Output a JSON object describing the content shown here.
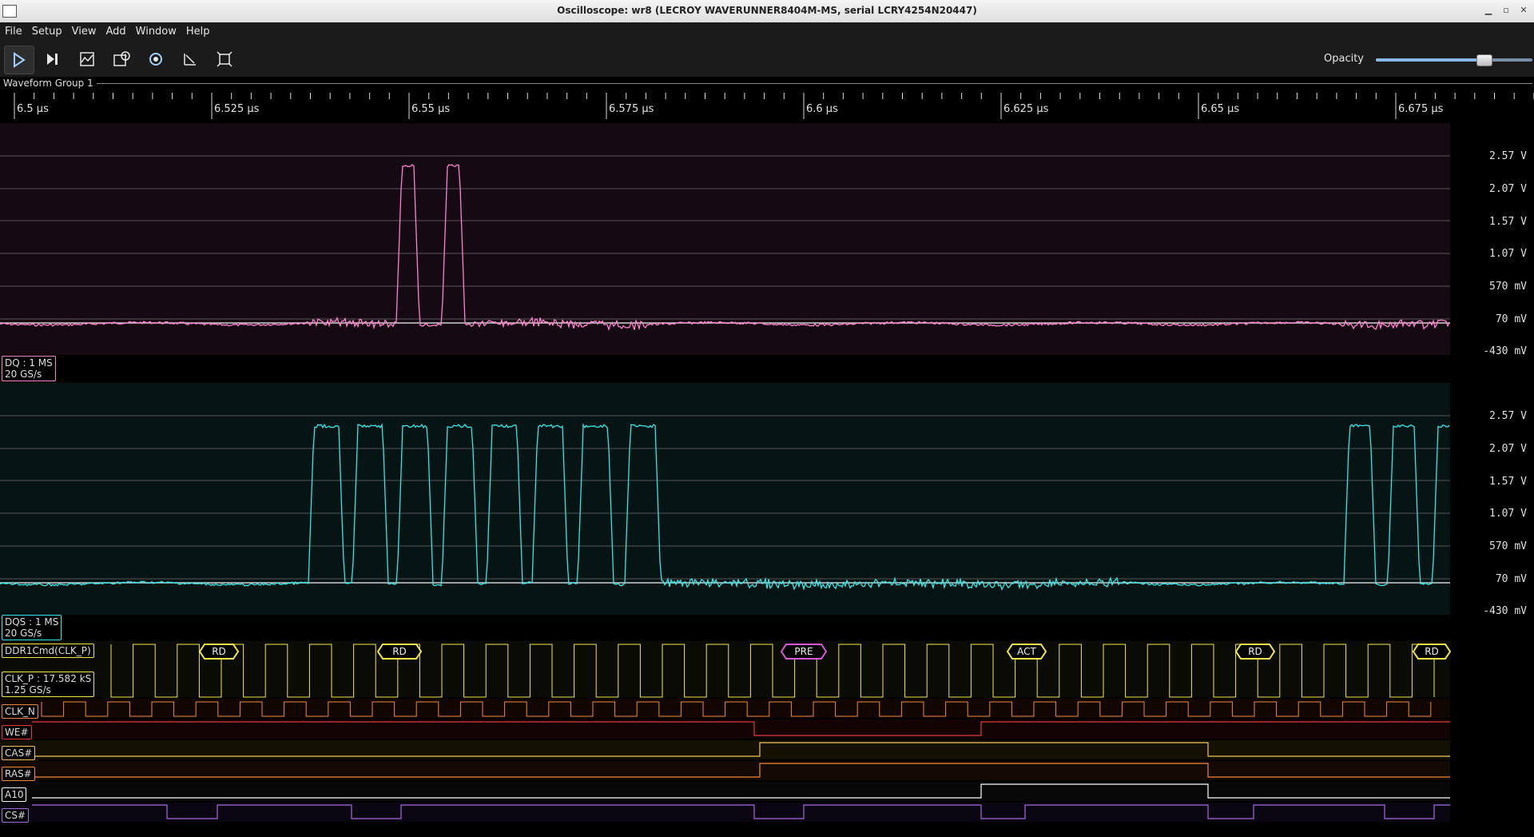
{
  "window": {
    "title": "Oscilloscope: wr8 (LECROY WAVERUNNER8404M-MS, serial LCRY4254N20447)"
  },
  "menu": [
    "File",
    "Setup",
    "View",
    "Add",
    "Window",
    "Help"
  ],
  "toolbar": {
    "buttons": [
      "start-trigger",
      "single-trigger",
      "history",
      "add-measurement",
      "settings",
      "analyze",
      "fullscreen"
    ],
    "opacity_label": "Opacity",
    "opacity_value": 0.69
  },
  "group": {
    "title": "Waveform Group 1"
  },
  "timeline": {
    "labels": [
      "6.5 µs",
      "6.525 µs",
      "6.55 µs",
      "6.575 µs",
      "6.6 µs",
      "6.625 µs",
      "6.65 µs",
      "6.675 µs"
    ]
  },
  "analog_channels": [
    {
      "name": "DQ",
      "info_line1": "DQ : 1 MS",
      "info_line2": "20 GS/s",
      "color": "#ff80d0",
      "bg_color": "#160a12",
      "volt_labels": [
        "2.57 V",
        "2.07 V",
        "1.57 V",
        "1.07 V",
        "570 mV",
        "70 mV",
        "-430 mV"
      ]
    },
    {
      "name": "DQS",
      "info_line1": "DQS : 1 MS",
      "info_line2": "20 GS/s",
      "color": "#33e8e8",
      "bg_color": "#061414",
      "volt_labels": [
        "2.57 V",
        "2.07 V",
        "1.57 V",
        "1.07 V",
        "570 mV",
        "70 mV",
        "-430 mV"
      ]
    }
  ],
  "protocol": {
    "name": "DDR1Cmd(CLK_P)",
    "color": "#f2e64a",
    "commands": [
      {
        "label": "RD",
        "color": "#f2e64a"
      },
      {
        "label": "RD",
        "color": "#f2e64a"
      },
      {
        "label": "PRE",
        "color": "#d65ad6"
      },
      {
        "label": "ACT",
        "color": "#f2e64a"
      },
      {
        "label": "RD",
        "color": "#f2e64a"
      },
      {
        "label": "RD",
        "color": "#f2e64a"
      }
    ]
  },
  "digital_channels": [
    {
      "name": "CLK_P",
      "info_line1": "CLK_P : 17.582 kS",
      "info_line2": "1.25 GS/s",
      "color": "#f2e64a"
    },
    {
      "name": "CLK_N",
      "color": "#f08a3a"
    },
    {
      "name": "WE#",
      "color": "#e03a3a"
    },
    {
      "name": "CAS#",
      "color": "#f5c55a"
    },
    {
      "name": "RAS#",
      "color": "#f08a3a"
    },
    {
      "name": "A10",
      "color": "#ffffff"
    },
    {
      "name": "CS#",
      "color": "#a66ae6"
    }
  ]
}
